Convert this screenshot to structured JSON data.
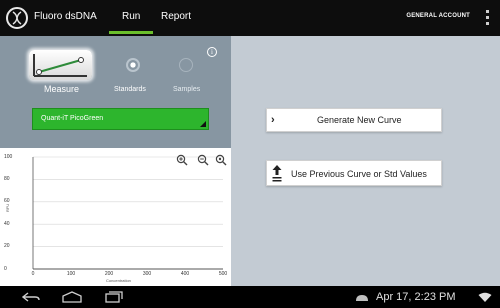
{
  "header": {
    "app_title": "Fluoro dsDNA",
    "tabs": [
      "Run",
      "Report"
    ],
    "active_tab": "Run",
    "account_label": "GENERAL ACCOUNT",
    "accent_color": "#6abe2b"
  },
  "mode_selector": {
    "modes": [
      "Measure",
      "Standards",
      "Samples"
    ],
    "selected": "Measure"
  },
  "dye_select": {
    "value": "Quant-iT PicoGreen"
  },
  "actions": {
    "generate_label": "Generate New Curve",
    "previous_label": "Use Previous Curve or Std Values"
  },
  "chart_data": {
    "type": "scatter",
    "xlabel": "Concentration",
    "ylabel": "RFU",
    "xlim": [
      0,
      500
    ],
    "ylim": [
      0,
      100
    ],
    "x_ticks": [
      "0",
      "100",
      "200",
      "300",
      "400",
      "500"
    ],
    "y_ticks": [
      "100",
      "80",
      "60",
      "40",
      "20",
      "0"
    ],
    "series": [],
    "grid": "horizontal"
  },
  "status_bar": {
    "datetime": "Apr 17, 2:23 PM"
  }
}
